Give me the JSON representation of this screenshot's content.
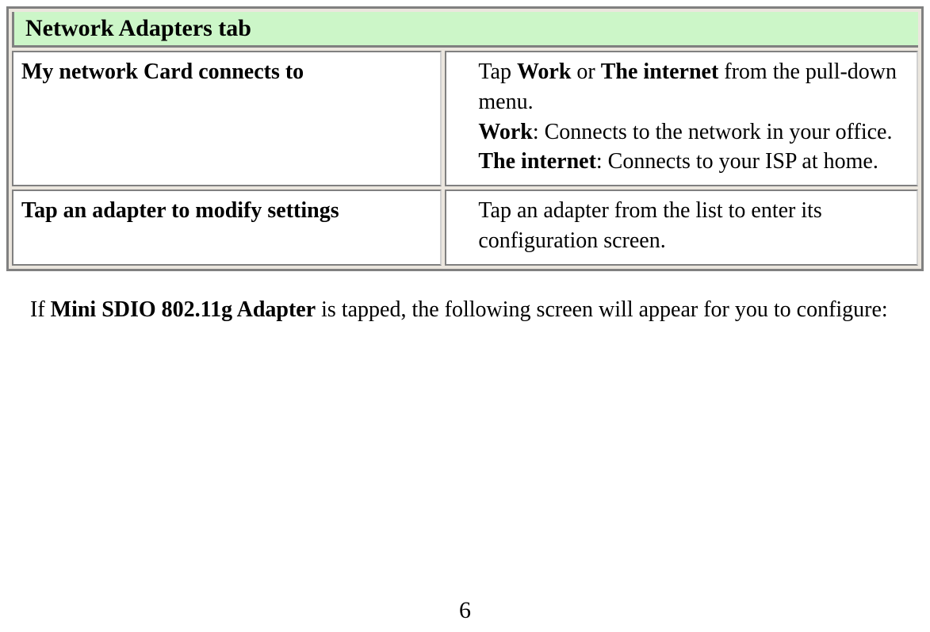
{
  "header": {
    "title": "Network Adapters tab"
  },
  "rows": [
    {
      "label": "My network Card connects to",
      "desc": {
        "line1_pre": "Tap ",
        "line1_b1": "Work",
        "line1_mid": " or ",
        "line1_b2": "The internet",
        "line1_post": " from the pull-down menu.",
        "work_b": "Work",
        "work_text": ": Connects to the network in your office.",
        "internet_b": "The internet",
        "internet_text": ": Connects to your ISP at home."
      }
    },
    {
      "label": "Tap an adapter to modify settings",
      "desc_plain": "Tap an adapter from the list to enter its configuration screen."
    }
  ],
  "note": {
    "pre": "If ",
    "bold": "Mini SDIO 802.11g Adapter",
    "post": " is tapped, the following screen will appear for you to configure:"
  },
  "page_number": "6"
}
